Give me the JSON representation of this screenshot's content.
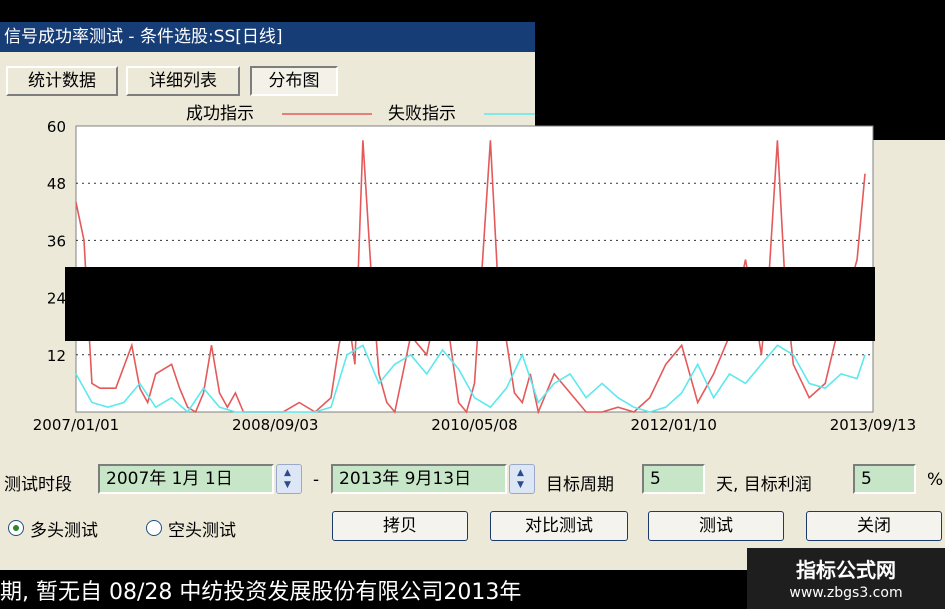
{
  "window": {
    "title": "信号成功率测试 - 条件选股:SS[日线]"
  },
  "tabs": [
    {
      "label": "统计数据"
    },
    {
      "label": "详细列表"
    },
    {
      "label": "分布图",
      "active": true
    }
  ],
  "chart_data": {
    "type": "line",
    "legend": [
      {
        "name": "成功指示",
        "color": "#e45a5a"
      },
      {
        "name": "失败指示",
        "color": "#5ee8ee"
      }
    ],
    "ylim": [
      0,
      60
    ],
    "yticks": [
      60,
      48,
      36,
      24,
      12
    ],
    "xticks": [
      "2007/01/01",
      "2008/09/03",
      "2010/05/08",
      "2012/01/10",
      "2013/09/13"
    ],
    "grid": "horizontal-dotted",
    "x_index_range": [
      0,
      100
    ],
    "series": [
      {
        "name": "成功指示",
        "color": "#e45a5a",
        "x": [
          0,
          1,
          2,
          3,
          5,
          7,
          8,
          9,
          10,
          12,
          13,
          14,
          15,
          16,
          17,
          18,
          19,
          20,
          21,
          22,
          24,
          26,
          28,
          30,
          32,
          33,
          34,
          35,
          36,
          37,
          38,
          39,
          40,
          42,
          44,
          46,
          47,
          48,
          49,
          50,
          52,
          53,
          54,
          55,
          56,
          57,
          58,
          60,
          62,
          64,
          66,
          68,
          70,
          72,
          74,
          76,
          78,
          80,
          82,
          84,
          86,
          87,
          88,
          89,
          90,
          92,
          94,
          96,
          98,
          99
        ],
        "values": [
          44,
          36,
          6,
          5,
          5,
          14,
          5,
          2,
          8,
          10,
          5,
          1,
          0,
          4,
          14,
          4,
          1,
          4,
          0,
          0,
          0,
          0,
          2,
          0,
          3,
          14,
          22,
          10,
          57,
          30,
          8,
          2,
          0,
          16,
          12,
          28,
          14,
          2,
          0,
          6,
          57,
          25,
          15,
          4,
          2,
          8,
          0,
          8,
          4,
          0,
          0,
          1,
          0,
          3,
          10,
          14,
          2,
          8,
          16,
          32,
          12,
          30,
          57,
          26,
          10,
          3,
          6,
          20,
          32,
          50
        ]
      },
      {
        "name": "失败指示",
        "color": "#5ee8ee",
        "x": [
          0,
          2,
          4,
          6,
          8,
          10,
          12,
          14,
          16,
          18,
          20,
          22,
          24,
          26,
          28,
          30,
          32,
          34,
          36,
          38,
          40,
          42,
          44,
          46,
          48,
          50,
          52,
          54,
          56,
          58,
          60,
          62,
          64,
          66,
          68,
          70,
          72,
          74,
          76,
          78,
          80,
          82,
          84,
          86,
          88,
          90,
          92,
          94,
          96,
          98,
          99
        ],
        "values": [
          8,
          2,
          1,
          2,
          6,
          1,
          3,
          0,
          5,
          1,
          0,
          0,
          0,
          0,
          0,
          0,
          1,
          12,
          14,
          6,
          10,
          12,
          8,
          13,
          9,
          3,
          1,
          5,
          12,
          2,
          6,
          8,
          3,
          6,
          3,
          1,
          0,
          1,
          4,
          10,
          3,
          8,
          6,
          10,
          14,
          12,
          6,
          5,
          8,
          7,
          12
        ]
      }
    ]
  },
  "controls": {
    "period_label": "测试时段",
    "start_date": "2007年 1月 1日",
    "dash": "-",
    "end_date": "2013年 9月13日",
    "target_period_label": "目标周期",
    "target_period_value": "5",
    "target_profit_label": "天, 目标利润",
    "target_profit_value": "5",
    "percent": "%",
    "radio_long_label": "多头测试",
    "radio_short_label": "空头测试",
    "radio_long_checked": true
  },
  "buttons": {
    "copy": "拷贝",
    "compare": "对比测试",
    "test": "测试",
    "close": "关闭"
  },
  "bottom": {
    "text": "期, 暂无自 08/28 中纺投资发展股份有限公司2013年"
  },
  "watermark": {
    "line1": "指标公式网",
    "line2": "www.zbgs3.com"
  },
  "colors": {
    "title_bar": "#173d77",
    "dialog_bg": "#ece9d8",
    "field_bg": "#c7e5c7"
  }
}
